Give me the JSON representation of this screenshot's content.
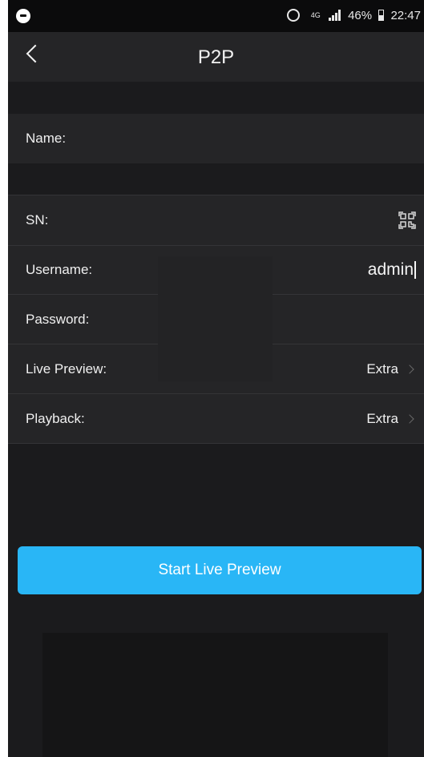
{
  "status_bar": {
    "network": "4G",
    "battery": "46%",
    "time": "22:47"
  },
  "header": {
    "title": "P2P"
  },
  "form": {
    "name_label": "Name:",
    "sn_label": "SN:",
    "username_label": "Username:",
    "username_value": "admin",
    "password_label": "Password:",
    "live_preview_label": "Live Preview:",
    "live_preview_value": "Extra",
    "playback_label": "Playback:",
    "playback_value": "Extra"
  },
  "actions": {
    "start_live_preview": "Start Live Preview"
  },
  "colors": {
    "accent": "#29b6f6",
    "background": "#1b1b1d",
    "row": "#252527"
  }
}
